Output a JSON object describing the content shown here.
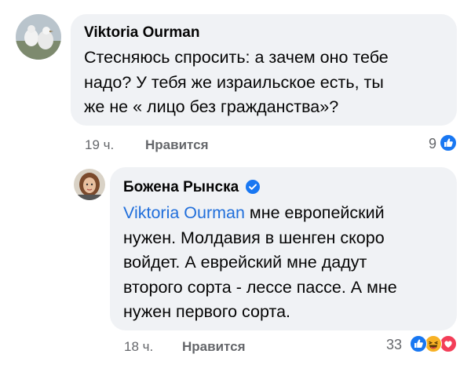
{
  "comment1": {
    "author": "Viktoria Ourman",
    "lines": [
      "Стесняюсь спросить: а зачем оно тебе",
      "надо? У тебя же израильское есть, ты",
      "же не « лицо без гражданства»?"
    ],
    "time": "19 ч.",
    "like_label": "Нравится",
    "reaction_count": "9",
    "reactions": [
      "like-icon"
    ]
  },
  "comment2": {
    "author": "Божена Рынска",
    "verified": true,
    "mention": "Viktoria Ourman",
    "lines": [
      " мне европейский",
      "нужен. Молдавия в шенген скоро",
      "войдет. А еврейский мне дадут",
      "второго сорта - лессе пассе.  А мне",
      "нужен первого сорта."
    ],
    "time": "18 ч.",
    "like_label": "Нравится",
    "reaction_count": "33",
    "reactions": [
      "like-icon",
      "haha-icon",
      "love-icon"
    ]
  },
  "colors": {
    "bubble": "#f0f2f5",
    "meta": "#65676b",
    "mention": "#216fdb",
    "like": "#1877f2",
    "haha": "#f7b125",
    "love": "#f33e58"
  }
}
